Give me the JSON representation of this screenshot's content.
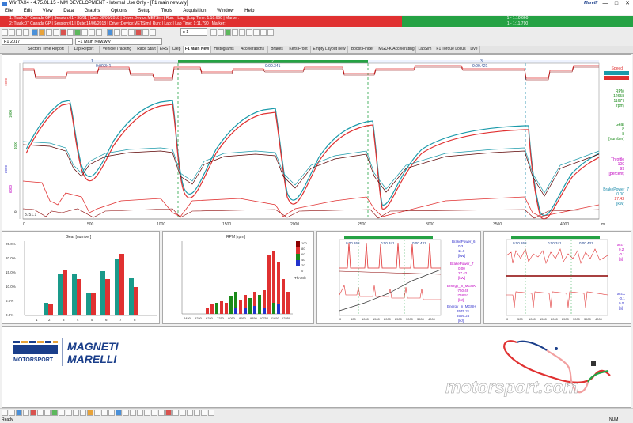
{
  "window": {
    "title": "WinTAX4 - 4.75.01.15 - MM DEVELOPMENT - Internal Use Only - [F1 main new.wly]",
    "logo": "Marelli",
    "minimize": "—",
    "maximize": "□",
    "close": "✕"
  },
  "menu": [
    "Eile",
    "Edit",
    "View",
    "Data",
    "Graphs",
    "Options",
    "Setup",
    "Tools",
    "Acquisition",
    "Window",
    "Help"
  ],
  "sessions": [
    {
      "label": "1: Track:07 Canada GP | Session:01 - 30/01 | Date:06/06/2018 | Driver:Device:METSim | Run: | Lap: | Lap Time: 1:10.660 | Marker:",
      "lap_label": "1 - 1:10.660",
      "color": "#e03131"
    },
    {
      "label": "2: Track:07 Canada GP | Session:01 | Date:14/06/2018 | Driver:Device:METSim | Run: | Lap: | Lap Time: 1:11.790 | Marker:",
      "lap_label": "1 - 1:11.790",
      "color": "#e03131"
    }
  ],
  "toolbar": {
    "project": "F1 2017",
    "layout": "F1 Main New.wly",
    "zoom": "x 1"
  },
  "tabs": [
    {
      "label": "Sectors Time Report",
      "active": false
    },
    {
      "label": "Lap Report",
      "active": false
    },
    {
      "label": "Vehicle Tracking",
      "active": false
    },
    {
      "label": "Race Start",
      "active": false
    },
    {
      "label": "ERS",
      "active": false
    },
    {
      "label": "Crep",
      "active": false
    },
    {
      "label": "F1 Main New",
      "active": true
    },
    {
      "label": "Histograms",
      "active": false
    },
    {
      "label": "Accelerations",
      "active": false
    },
    {
      "label": "Brakes",
      "active": false
    },
    {
      "label": "Kers Front",
      "active": false
    },
    {
      "label": "Empty Layout new",
      "active": false
    },
    {
      "label": "Boost Finder",
      "active": false
    },
    {
      "label": "MGU-K Accelerating",
      "active": false
    },
    {
      "label": "LapSim",
      "active": false
    },
    {
      "label": "F1 Torque Locus",
      "active": false
    },
    {
      "label": "Live",
      "active": false
    }
  ],
  "main_graph": {
    "sectors": [
      {
        "name": "1",
        "time": "0:00.341",
        "time2": "0:00.341"
      },
      {
        "name": "2",
        "time": "0:00.341",
        "time2": "0:00.343"
      },
      {
        "name": "3",
        "time": "0:00.421",
        "time2": "0:00.421"
      }
    ],
    "cursor_value": "3751.1",
    "x_ticks": [
      "0",
      "500",
      "1000",
      "1500",
      "2000",
      "2500",
      "3000",
      "3500",
      "4000"
    ],
    "x_unit": "m",
    "channels": [
      {
        "name": "Speed",
        "values": [
          "",
          ""
        ],
        "unit": "",
        "color": "#e03131"
      },
      {
        "name": "RPM",
        "values": [
          "12658",
          "11677"
        ],
        "unit": "[rpm]",
        "color": "#1a8a1a"
      },
      {
        "name": "Gear",
        "values": [
          "8",
          "8"
        ],
        "unit": "[number]",
        "color": "#1a8a1a"
      },
      {
        "name": "Throttle",
        "values": [
          "100",
          "99"
        ],
        "unit": "[percent]",
        "color": "#c000c0"
      },
      {
        "name": "BrakePower_7",
        "values": [
          "0.00",
          "27.42"
        ],
        "unit": "[kW]",
        "color": "#1a8aaa"
      }
    ],
    "left_axis": [
      "1000",
      "1000",
      "4000",
      "2000",
      "6000",
      "0"
    ]
  },
  "gear_hist": {
    "title": "Gear [number]",
    "y_ticks": [
      "25.0%",
      "20.0%",
      "15.0%",
      "10.0%",
      "5.0%",
      "0.0%"
    ],
    "x_ticks": [
      "1",
      "2",
      "3",
      "4",
      "5",
      "6",
      "7",
      "8"
    ]
  },
  "rpm_hist": {
    "title": "RPM [rpm]",
    "legend_title": "Throttle",
    "legend_ticks": [
      "100",
      "80",
      "60",
      "40",
      "20",
      "0"
    ],
    "x_ticks": [
      "4450",
      "5250",
      "6250",
      "7250",
      "8050",
      "8950",
      "9850",
      "10750",
      "11650",
      "12550"
    ]
  },
  "brake_panel": {
    "sectors": [
      "0:00.268",
      "0:00.341",
      "0:00.431"
    ],
    "x_ticks": [
      "0",
      "500",
      "1000",
      "1500",
      "2000",
      "2500",
      "3000",
      "3500",
      "4000"
    ],
    "channels": [
      {
        "name": "BrakePower_6",
        "values": [
          "0.3",
          "11.0"
        ],
        "unit": "[kW]",
        "color": "#3333cc"
      },
      {
        "name": "BrakePower_7",
        "values": [
          "0.00",
          "27.42"
        ],
        "unit": "[kW]",
        "color": "#c000c0"
      },
      {
        "name": "Energy_in_MGUK",
        "values": [
          "-750.49",
          "-758.51"
        ],
        "unit": "[kJ]",
        "color": "#c000c0"
      },
      {
        "name": "Energy_in_MGUH",
        "values": [
          "3575.21",
          "3595.25"
        ],
        "unit": "[kJ]",
        "color": "#3333cc"
      }
    ]
  },
  "accel_panel": {
    "sectors": [
      "0:00.268",
      "0:00.341",
      "0:00.431"
    ],
    "x_ticks": [
      "0",
      "500",
      "1000",
      "1500",
      "2000",
      "2500",
      "3000",
      "3500",
      "4000"
    ],
    "channels": [
      {
        "name": "accY",
        "values": [
          "0.2",
          "-0.1"
        ],
        "unit": "[g]",
        "color": "#c000c0"
      },
      {
        "name": "accX",
        "values": [
          "-0.1",
          "0.0"
        ],
        "unit": "[g]",
        "color": "#3333cc"
      }
    ]
  },
  "logos": {
    "mm_text": "MOTORSPORT",
    "mm_brand": "MAGNETI",
    "mm_brand2": "MARELLI",
    "watermark": "motorsport.com"
  },
  "status": {
    "left": "Ready",
    "right": "NUM"
  }
}
